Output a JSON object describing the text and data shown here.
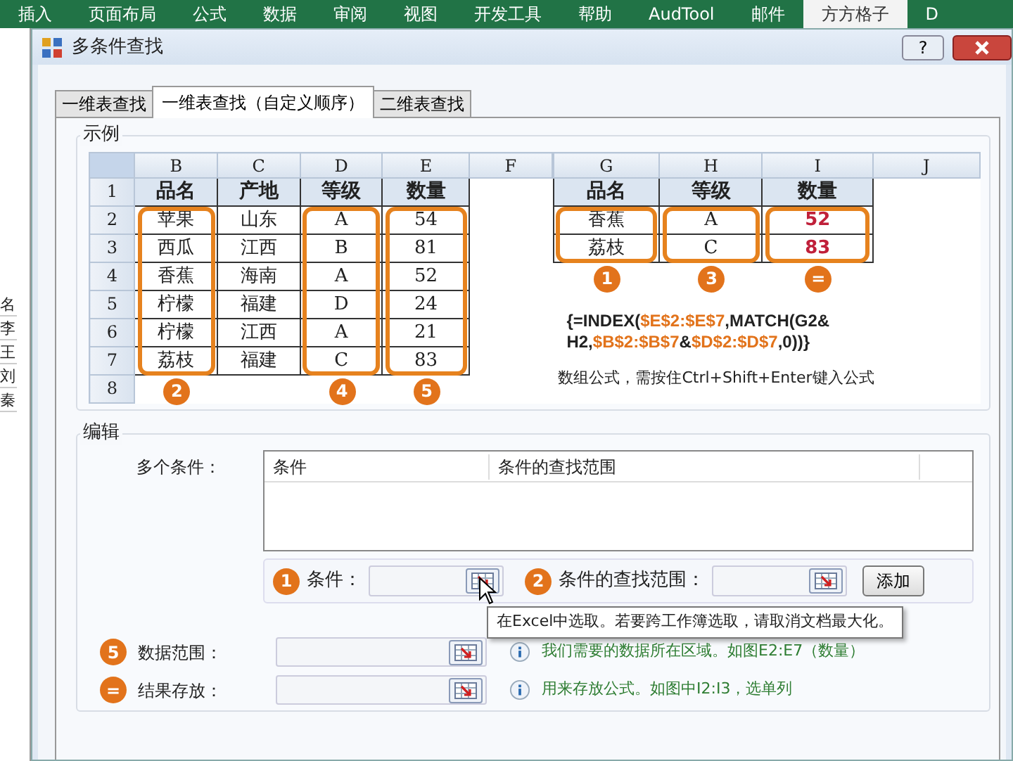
{
  "ribbon_tabs": [
    {
      "label": "插入",
      "selected": false
    },
    {
      "label": "页面布局",
      "selected": false
    },
    {
      "label": "公式",
      "selected": false
    },
    {
      "label": "数据",
      "selected": false
    },
    {
      "label": "审阅",
      "selected": false
    },
    {
      "label": "视图",
      "selected": false
    },
    {
      "label": "开发工具",
      "selected": false
    },
    {
      "label": "帮助",
      "selected": false
    },
    {
      "label": "AudTool",
      "selected": false
    },
    {
      "label": "邮件",
      "selected": false
    },
    {
      "label": "方方格子",
      "selected": true
    },
    {
      "label": "D",
      "selected": false
    }
  ],
  "sheet_strip": [
    "名",
    "李",
    "王",
    "刘",
    "秦"
  ],
  "window": {
    "title": "多条件查找",
    "help": "?"
  },
  "tabs": [
    {
      "label": "一维表查找",
      "selected": false
    },
    {
      "label": "一维表查找（自定义顺序）",
      "selected": true
    },
    {
      "label": "二维表查找",
      "selected": false
    }
  ],
  "example": {
    "title": "示例",
    "left_sheet": {
      "column_letters": [
        {
          "label": "B",
          "outlined": true,
          "badge": "2"
        },
        {
          "label": "C",
          "outlined": false
        },
        {
          "label": "D",
          "outlined": true,
          "badge": "4"
        },
        {
          "label": "E",
          "outlined": true,
          "badge": "5"
        },
        {
          "label": "F",
          "outlined": false
        }
      ],
      "rows": [
        {
          "number": "1",
          "cells": [
            {
              "text": "品名",
              "kind": "header"
            },
            {
              "text": "产地",
              "kind": "header"
            },
            {
              "text": "等级",
              "kind": "header"
            },
            {
              "text": "数量",
              "kind": "header"
            }
          ]
        },
        {
          "number": "2",
          "cells": [
            {
              "text": "苹果",
              "kind": "data"
            },
            {
              "text": "山东",
              "kind": "data"
            },
            {
              "text": "A",
              "kind": "data"
            },
            {
              "text": "54",
              "kind": "data"
            }
          ]
        },
        {
          "number": "3",
          "cells": [
            {
              "text": "西瓜",
              "kind": "data"
            },
            {
              "text": "江西",
              "kind": "data"
            },
            {
              "text": "B",
              "kind": "data"
            },
            {
              "text": "81",
              "kind": "data"
            }
          ]
        },
        {
          "number": "4",
          "cells": [
            {
              "text": "香蕉",
              "kind": "data"
            },
            {
              "text": "海南",
              "kind": "data"
            },
            {
              "text": "A",
              "kind": "data"
            },
            {
              "text": "52",
              "kind": "data"
            }
          ]
        },
        {
          "number": "5",
          "cells": [
            {
              "text": "柠檬",
              "kind": "data"
            },
            {
              "text": "福建",
              "kind": "data"
            },
            {
              "text": "D",
              "kind": "data"
            },
            {
              "text": "24",
              "kind": "data"
            }
          ]
        },
        {
          "number": "6",
          "cells": [
            {
              "text": "柠檬",
              "kind": "data"
            },
            {
              "text": "江西",
              "kind": "data"
            },
            {
              "text": "A",
              "kind": "data"
            },
            {
              "text": "21",
              "kind": "data"
            }
          ]
        },
        {
          "number": "7",
          "cells": [
            {
              "text": "荔枝",
              "kind": "data"
            },
            {
              "text": "福建",
              "kind": "data"
            },
            {
              "text": "C",
              "kind": "data"
            },
            {
              "text": "83",
              "kind": "data"
            }
          ]
        },
        {
          "number": "8",
          "cells": []
        }
      ]
    },
    "right_sheet": {
      "column_letters": [
        {
          "label": "G",
          "outlined": true,
          "badge": "1"
        },
        {
          "label": "H",
          "outlined": true,
          "badge": "3"
        },
        {
          "label": "I",
          "outlined": true,
          "badge": "="
        },
        {
          "label": "J",
          "outlined": false
        }
      ],
      "rows": [
        {
          "cells": [
            {
              "text": "品名",
              "kind": "header"
            },
            {
              "text": "等级",
              "kind": "header"
            },
            {
              "text": "数量",
              "kind": "header"
            }
          ]
        },
        {
          "cells": [
            {
              "text": "香蕉",
              "kind": "data"
            },
            {
              "text": "A",
              "kind": "data"
            },
            {
              "text": "52",
              "kind": "result"
            }
          ]
        },
        {
          "cells": [
            {
              "text": "荔枝",
              "kind": "data"
            },
            {
              "text": "C",
              "kind": "data"
            },
            {
              "text": "83",
              "kind": "result"
            }
          ]
        }
      ]
    },
    "formula_lines": [
      [
        {
          "kind": "plain",
          "text": "{=INDEX("
        },
        {
          "kind": "ref",
          "text": "$E$2:$E$7"
        },
        {
          "kind": "plain",
          "text": ",MATCH(G2&"
        }
      ],
      [
        {
          "kind": "plain",
          "text": "H2,"
        },
        {
          "kind": "ref",
          "text": "$B$2:$B$7"
        },
        {
          "kind": "plain",
          "text": "&"
        },
        {
          "kind": "ref",
          "text": "$D$2:$D$7"
        },
        {
          "kind": "plain",
          "text": ",0))}"
        }
      ]
    ],
    "note": "数组公式，需按住Ctrl+Shift+Enter键入公式"
  },
  "edit": {
    "title": "编辑",
    "list_label": "多个条件：",
    "list_columns": [
      "条件",
      "条件的查找范围"
    ],
    "condition_fields": [
      {
        "badge": "1",
        "label": "条件："
      },
      {
        "badge": "2",
        "label": "条件的查找范围："
      }
    ],
    "add_button": "添加",
    "tooltip": "在Excel中选取。若要跨工作簿选取，请取消文档最大化。",
    "fields": [
      {
        "badge": "5",
        "label": "数据范围：",
        "hint": "我们需要的数据所在区域。如图E2:E7（数量）"
      },
      {
        "badge": "=",
        "label": "结果存放：",
        "hint": "用来存放公式。如图中I2:I3，选单列"
      }
    ]
  }
}
